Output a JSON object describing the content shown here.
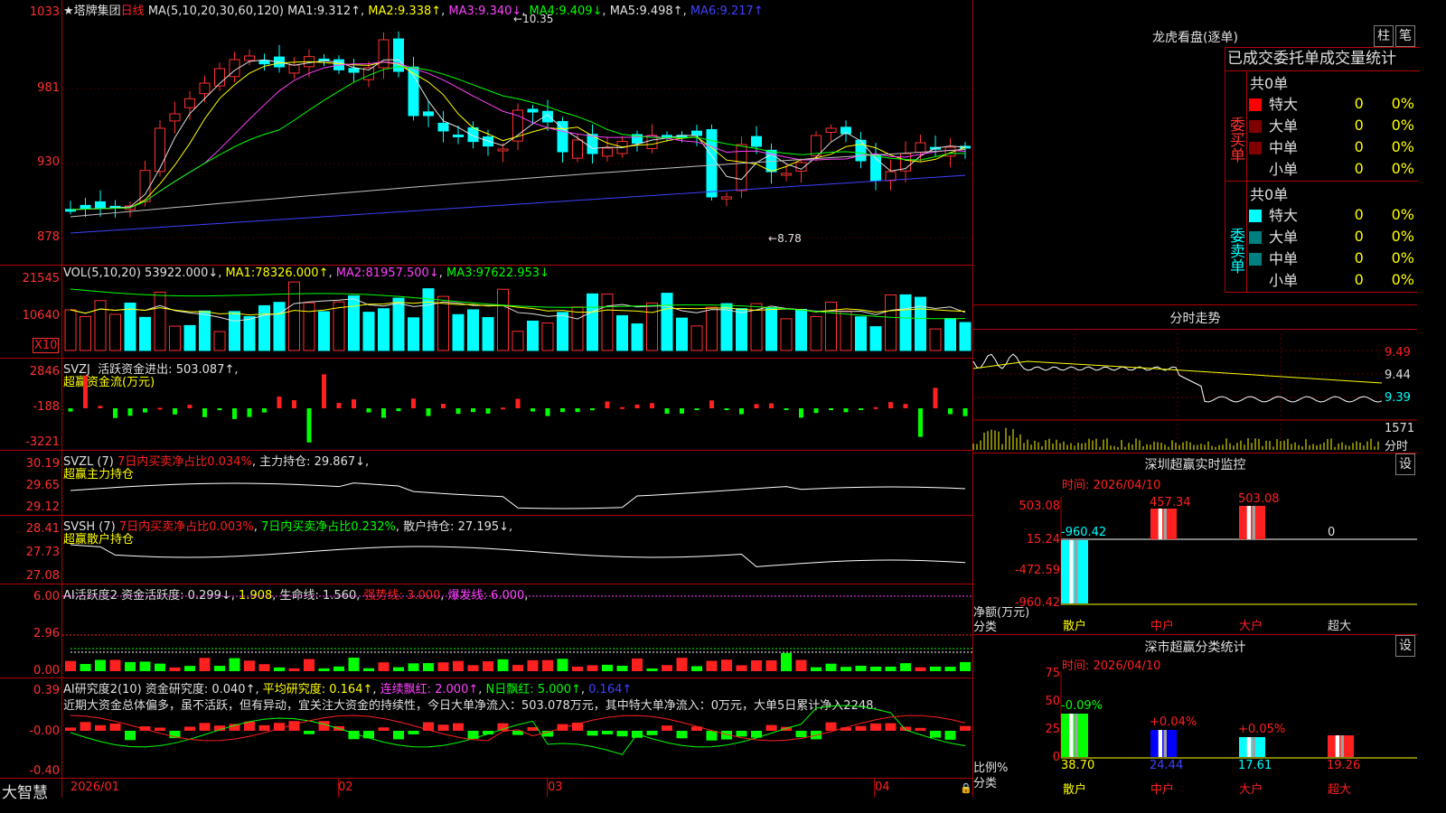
{
  "stock": {
    "name": "★塔牌集团",
    "period": "日线"
  },
  "main": {
    "ma_params": "MA(5,10,20,30,60,120)",
    "ma_items": [
      {
        "label": "MA1:",
        "value": "9.312↑"
      },
      {
        "label": "MA2:",
        "value": "9.338↑"
      },
      {
        "label": "MA3:",
        "value": "9.340↓"
      },
      {
        "label": "MA4:",
        "value": "9.409↓"
      },
      {
        "label": "MA5:",
        "value": "9.498↑"
      },
      {
        "label": "MA6:",
        "value": "9.217↑"
      }
    ],
    "y_labels": [
      "1033",
      "981",
      "930",
      "878"
    ],
    "high_label": "10.35",
    "low_label": "8.78"
  },
  "vol": {
    "params": "VOL(5,10,20)",
    "value": "53922.000↓",
    "items": [
      {
        "label": "MA1:",
        "value": "78326.000↑"
      },
      {
        "label": "MA2:",
        "value": "81957.500↓"
      },
      {
        "label": "MA3:",
        "value": "97622.953↓"
      }
    ],
    "y_labels": [
      "21545",
      "10640"
    ],
    "unit": "X10"
  },
  "svzj": {
    "name": "SVZJ",
    "label": "活跃资金进出:",
    "value": "503.087↑",
    "sub": "超赢资金流(万元)",
    "y_labels": [
      "2846",
      "-188",
      "-3221"
    ]
  },
  "svzl": {
    "name": "SVZL (7)",
    "label1": "7日内买卖净占比0.034%",
    "label2": "主力持仓:",
    "value": "29.867↓",
    "sub": "超赢主力持仓",
    "y_labels": [
      "30.19",
      "29.65",
      "29.12"
    ]
  },
  "svsh": {
    "name": "SVSH (7)",
    "label1": "7日内买卖净占比0.003%",
    "label2": "7日内买卖净占比0.232%",
    "label3": "散户持仓:",
    "value": "27.195↓",
    "sub": "超赢散户持仓",
    "y_labels": [
      "28.41",
      "27.73",
      "27.08"
    ]
  },
  "ai1": {
    "name": "AI活跃度2",
    "label": "资金活跃度:",
    "v1": "0.299↓",
    "v2": "1.908",
    "life": "生命线: 1.560",
    "strong": "强势线: 3.000",
    "burst": "爆发线: 6.000",
    "y_labels": [
      "6.00",
      "2.96",
      "0.00"
    ]
  },
  "ai2": {
    "name": "AI研究度2(10)",
    "label": "资金研究度:",
    "v1": "0.040↑",
    "avg": "平均研究度: 0.164↑",
    "streak": "连续飘红: 2.000↑",
    "nday": "N日飘红: 5.000↑",
    "v2": "0.164↑",
    "comment": "近期大资金总体偏多，虽不活跃，但有异动，宜关注大资金的持续性，今日大单净流入：503.078万元，其中特大单净流入：0万元，大单5日累计净入2248.",
    "y_labels": [
      "0.39",
      "-0.00",
      "-0.40"
    ]
  },
  "xaxis": {
    "brand": "大智慧",
    "labels": [
      "2026/01",
      "02",
      "03",
      "04"
    ]
  },
  "dragon": {
    "title": "龙虎看盘(逐单)",
    "btn1": "柱",
    "btn2": "笔",
    "header": "已成交委托单成交量统计",
    "buy_label": "委买单",
    "sell_label": "委卖单",
    "count": "共0单",
    "rows": [
      {
        "name": "特大",
        "v": "0",
        "pct": "0%"
      },
      {
        "name": "大单",
        "v": "0",
        "pct": "0%"
      },
      {
        "name": "中单",
        "v": "0",
        "pct": "0%"
      },
      {
        "name": "小单",
        "v": "0",
        "pct": "0%"
      }
    ],
    "buy_colors": [
      "#ff0000",
      "#800000",
      "#800000",
      "#000000"
    ],
    "sell_colors": [
      "#00ffff",
      "#008080",
      "#008080",
      "#000000"
    ]
  },
  "intraday": {
    "title": "分时走势",
    "y_labels": [
      "9.49",
      "9.44",
      "9.39"
    ],
    "vol_label": "1571",
    "vol_unit": "分时"
  },
  "monitor": {
    "title": "深圳超赢实时监控",
    "btn": "设",
    "time": "时间: 2026/04/10",
    "y_labels": [
      "503.08",
      "15.24",
      "-472.59",
      "-960.42"
    ],
    "unit": "净额(万元)",
    "cat_label": "分类",
    "cats": [
      "散户",
      "中户",
      "大户",
      "超大"
    ],
    "values": [
      "-960.42",
      "457.34",
      "503.08",
      "0"
    ]
  },
  "classify": {
    "title": "深市超赢分类统计",
    "btn": "设",
    "time": "时间: 2026/04/10",
    "y_labels": [
      "75",
      "50",
      "25",
      "0"
    ],
    "unit": "比例%",
    "cat_label": "分类",
    "cats": [
      "散户",
      "中户",
      "大户",
      "超大"
    ],
    "pcts": [
      "-0.09%",
      "+0.04%",
      "+0.05%",
      ""
    ],
    "values": [
      "38.70",
      "24.44",
      "17.61",
      "19.26"
    ]
  }
}
